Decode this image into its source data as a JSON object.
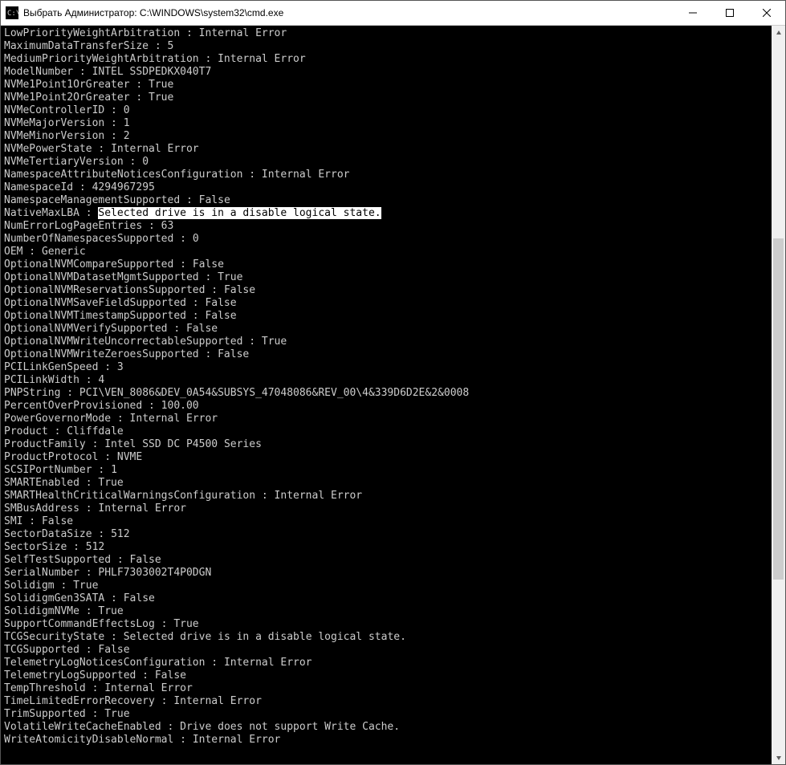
{
  "titlebar": {
    "title": "Выбрать Администратор: C:\\WINDOWS\\system32\\cmd.exe"
  },
  "selected_text": "Selected drive is in a disable logical state.",
  "lines": [
    {
      "key": "LowPriorityWeightArbitration",
      "val": "Internal Error"
    },
    {
      "key": "MaximumDataTransferSize",
      "val": "5"
    },
    {
      "key": "MediumPriorityWeightArbitration",
      "val": "Internal Error"
    },
    {
      "key": "ModelNumber",
      "val": "INTEL SSDPEDKX040T7"
    },
    {
      "key": "NVMe1Point1OrGreater",
      "val": "True"
    },
    {
      "key": "NVMe1Point2OrGreater",
      "val": "True"
    },
    {
      "key": "NVMeControllerID",
      "val": "0"
    },
    {
      "key": "NVMeMajorVersion",
      "val": "1"
    },
    {
      "key": "NVMeMinorVersion",
      "val": "2"
    },
    {
      "key": "NVMePowerState",
      "val": "Internal Error"
    },
    {
      "key": "NVMeTertiaryVersion",
      "val": "0"
    },
    {
      "key": "NamespaceAttributeNoticesConfiguration",
      "val": "Internal Error"
    },
    {
      "key": "NamespaceId",
      "val": "4294967295"
    },
    {
      "key": "NamespaceManagementSupported",
      "val": "False"
    },
    {
      "key": "NativeMaxLBA",
      "val": "Selected drive is in a disable logical state.",
      "highlight": true
    },
    {
      "key": "NumErrorLogPageEntries",
      "val": "63"
    },
    {
      "key": "NumberOfNamespacesSupported",
      "val": "0"
    },
    {
      "key": "OEM",
      "val": "Generic"
    },
    {
      "key": "OptionalNVMCompareSupported",
      "val": "False"
    },
    {
      "key": "OptionalNVMDatasetMgmtSupported",
      "val": "True"
    },
    {
      "key": "OptionalNVMReservationsSupported",
      "val": "False"
    },
    {
      "key": "OptionalNVMSaveFieldSupported",
      "val": "False"
    },
    {
      "key": "OptionalNVMTimestampSupported",
      "val": "False"
    },
    {
      "key": "OptionalNVMVerifySupported",
      "val": "False"
    },
    {
      "key": "OptionalNVMWriteUncorrectableSupported",
      "val": "True"
    },
    {
      "key": "OptionalNVMWriteZeroesSupported",
      "val": "False"
    },
    {
      "key": "PCILinkGenSpeed",
      "val": "3"
    },
    {
      "key": "PCILinkWidth",
      "val": "4"
    },
    {
      "key": "PNPString",
      "val": "PCI\\VEN_8086&DEV_0A54&SUBSYS_47048086&REV_00\\4&339D6D2E&2&0008"
    },
    {
      "key": "PercentOverProvisioned",
      "val": "100.00"
    },
    {
      "key": "PowerGovernorMode",
      "val": "Internal Error"
    },
    {
      "key": "Product",
      "val": "Cliffdale"
    },
    {
      "key": "ProductFamily",
      "val": "Intel SSD DC P4500 Series"
    },
    {
      "key": "ProductProtocol",
      "val": "NVME"
    },
    {
      "key": "SCSIPortNumber",
      "val": "1"
    },
    {
      "key": "SMARTEnabled",
      "val": "True"
    },
    {
      "key": "SMARTHealthCriticalWarningsConfiguration",
      "val": "Internal Error"
    },
    {
      "key": "SMBusAddress",
      "val": "Internal Error"
    },
    {
      "key": "SMI",
      "val": "False"
    },
    {
      "key": "SectorDataSize",
      "val": "512"
    },
    {
      "key": "SectorSize",
      "val": "512"
    },
    {
      "key": "SelfTestSupported",
      "val": "False"
    },
    {
      "key": "SerialNumber",
      "val": "PHLF7303002T4P0DGN"
    },
    {
      "key": "Solidigm",
      "val": "True"
    },
    {
      "key": "SolidigmGen3SATA",
      "val": "False"
    },
    {
      "key": "SolidigmNVMe",
      "val": "True"
    },
    {
      "key": "SupportCommandEffectsLog",
      "val": "True"
    },
    {
      "key": "TCGSecurityState",
      "val": "Selected drive is in a disable logical state."
    },
    {
      "key": "TCGSupported",
      "val": "False"
    },
    {
      "key": "TelemetryLogNoticesConfiguration",
      "val": "Internal Error"
    },
    {
      "key": "TelemetryLogSupported",
      "val": "False"
    },
    {
      "key": "TempThreshold",
      "val": "Internal Error"
    },
    {
      "key": "TimeLimitedErrorRecovery",
      "val": "Internal Error"
    },
    {
      "key": "TrimSupported",
      "val": "True"
    },
    {
      "key": "VolatileWriteCacheEnabled",
      "val": "Drive does not support Write Cache."
    },
    {
      "key": "WriteAtomicityDisableNormal",
      "val": "Internal Error"
    }
  ]
}
